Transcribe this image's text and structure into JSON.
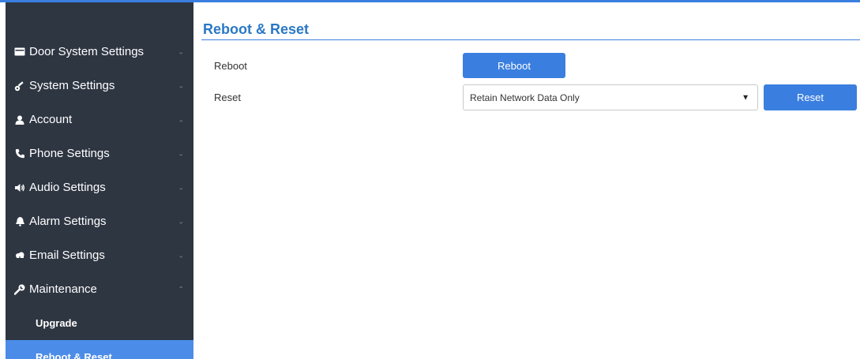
{
  "colors": {
    "sidebar_bg": "#2e3642",
    "accent": "#3a7fe0",
    "active_item": "#4b8ce8",
    "title": "#2a78c5"
  },
  "sidebar": {
    "items": [
      {
        "label": "Door System Settings",
        "icon": "door-icon",
        "chevron": "⌄"
      },
      {
        "label": "System Settings",
        "icon": "settings-key-icon",
        "chevron": "⌄"
      },
      {
        "label": "Account",
        "icon": "user-icon",
        "chevron": "⌄"
      },
      {
        "label": "Phone Settings",
        "icon": "phone-icon",
        "chevron": "⌄"
      },
      {
        "label": "Audio Settings",
        "icon": "speaker-icon",
        "chevron": "⌄"
      },
      {
        "label": "Alarm Settings",
        "icon": "bell-icon",
        "chevron": "⌄"
      },
      {
        "label": "Email Settings",
        "icon": "cloud-icon",
        "chevron": "⌄"
      },
      {
        "label": "Maintenance",
        "icon": "wrench-icon",
        "chevron": "⌃"
      }
    ],
    "subitems": [
      {
        "label": "Upgrade",
        "active": false
      },
      {
        "label": "Reboot & Reset",
        "active": true
      }
    ]
  },
  "main": {
    "title": "Reboot & Reset",
    "reboot": {
      "label": "Reboot",
      "button_label": "Reboot"
    },
    "reset": {
      "label": "Reset",
      "selected_option": "Retain Network Data Only",
      "button_label": "Reset"
    }
  }
}
